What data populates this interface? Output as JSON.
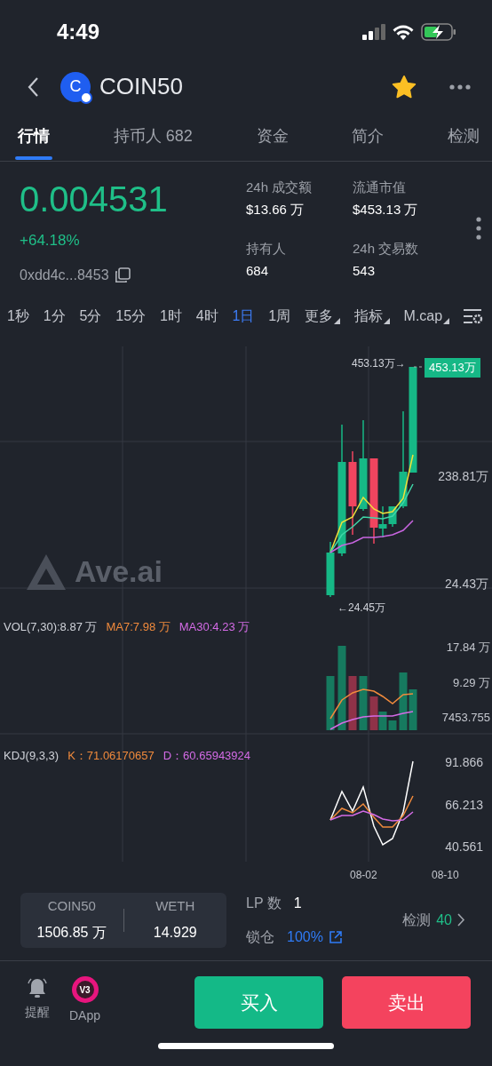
{
  "status_bar": {
    "time": "4:49"
  },
  "header": {
    "avatar_letter": "C",
    "title": "COIN50",
    "favorite": true
  },
  "tabs": [
    {
      "label": "行情",
      "selected": true
    },
    {
      "label": "持币人 682",
      "selected": false
    },
    {
      "label": "资金",
      "selected": false
    },
    {
      "label": "简介",
      "selected": false
    },
    {
      "label": "检测",
      "selected": false
    }
  ],
  "stats": {
    "price": "0.004531",
    "change": "+64.18%",
    "address": "0xdd4c...8453",
    "metrics": [
      {
        "label": "24h 成交额",
        "value": "$13.66 万"
      },
      {
        "label": "流通市值",
        "value": "$453.13 万"
      },
      {
        "label": "持有人",
        "value": "684"
      },
      {
        "label": "24h 交易数",
        "value": "543"
      }
    ]
  },
  "timeframes": [
    {
      "label": "1秒",
      "kind": "option",
      "selected": false
    },
    {
      "label": "1分",
      "kind": "option",
      "selected": false
    },
    {
      "label": "5分",
      "kind": "option",
      "selected": false
    },
    {
      "label": "15分",
      "kind": "option",
      "selected": false
    },
    {
      "label": "1时",
      "kind": "option",
      "selected": false
    },
    {
      "label": "4时",
      "kind": "option",
      "selected": false
    },
    {
      "label": "1日",
      "kind": "option",
      "selected": true
    },
    {
      "label": "1周",
      "kind": "option",
      "selected": false
    },
    {
      "label": "更多",
      "kind": "dropdown",
      "selected": false
    },
    {
      "label": "指标",
      "kind": "dropdown",
      "selected": false
    },
    {
      "label": "M.cap",
      "kind": "dropdown",
      "selected": false
    }
  ],
  "chart": {
    "watermark": "Ave.ai",
    "high_marker": "453.13万→",
    "current_tag": "453.13万",
    "axis_labels": [
      "238.81万",
      "24.43万"
    ],
    "low_marker": "←24.45万"
  },
  "volume": {
    "legend": [
      {
        "text": "VOL(7,30):8.87 万",
        "color": "#d0d3da"
      },
      {
        "text": "MA7:7.98 万",
        "color": "#f08a3c"
      },
      {
        "text": "MA30:4.23 万",
        "color": "#d46be6"
      }
    ],
    "axis_labels": [
      "17.84 万",
      "9.29 万",
      "7453.755"
    ]
  },
  "kdj": {
    "legend": [
      {
        "text": "KDJ(9,3,3)",
        "color": "#d0d3da"
      },
      {
        "text": "K：71.06170657",
        "color": "#f08a3c"
      },
      {
        "text": "D：60.65943924",
        "color": "#d46be6"
      }
    ],
    "axis_labels": [
      "91.866",
      "66.213",
      "40.561"
    ]
  },
  "dates": [
    "08-02",
    "08-10"
  ],
  "pool": {
    "tokens": [
      {
        "symbol": "COIN50",
        "amount": "1506.85 万"
      },
      {
        "symbol": "WETH",
        "amount": "14.929"
      }
    ],
    "lp_label": "LP 数",
    "lp_value": "1",
    "lock_label": "锁仓",
    "lock_value": "100%",
    "check_label": "检测",
    "check_value": "40"
  },
  "bottom": {
    "nav": [
      {
        "label": "提醒",
        "kind": "bell"
      },
      {
        "label": "DApp",
        "kind": "dapp"
      }
    ],
    "dapp_badge": "V3",
    "buttons": [
      {
        "label": "买入",
        "kind": "buy"
      },
      {
        "label": "卖出",
        "kind": "sell"
      }
    ]
  }
}
